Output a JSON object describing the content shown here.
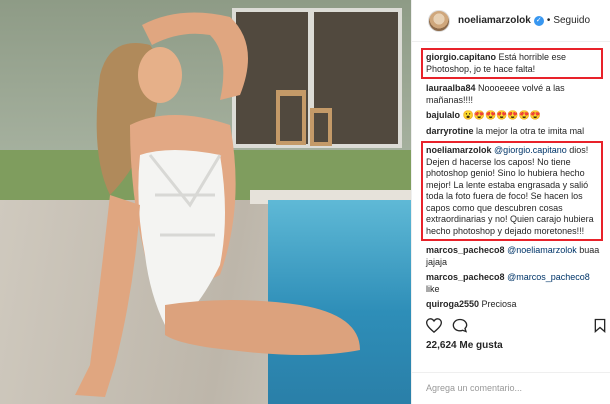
{
  "header": {
    "username": "noeliamarzolok",
    "dot": "•",
    "follow_label": "Seguido"
  },
  "comments": [
    {
      "user": "giorgio.capitano",
      "text": "Está horrible ese Photoshop, jo te hace falta!",
      "highlighted": true
    },
    {
      "user": "lauraalba84",
      "text": "Noooeeee volvé a las mañanas!!!!",
      "highlighted": false
    },
    {
      "user": "bajulalo",
      "text": "😮😍😍😍😍😍😍",
      "highlighted": false
    },
    {
      "user": "darryrotine",
      "text": "la mejor la otra te imita mal",
      "highlighted": false
    },
    {
      "user": "noeliamarzolok",
      "mention": "@giorgio.capitano",
      "text": "dios! Dejen d hacerse los capos! No tiene photoshop genio! Sino lo hubiera hecho mejor! La lente estaba engrasada y salió toda la foto fuera de foco! Se hacen los capos como que descubren cosas extraordinarias y no! Quien carajo hubiera hecho photoshop y dejado moretones!!!",
      "highlighted": true
    },
    {
      "user": "marcos_pacheco8",
      "mention": "@noeliamarzolok",
      "text": "buaa jajaja",
      "highlighted": false
    },
    {
      "user": "marcos_pacheco8",
      "mention": "@marcos_pacheco8",
      "text": "like",
      "highlighted": false
    },
    {
      "user": "quiroga2550",
      "text": "Preciosa",
      "highlighted": false
    }
  ],
  "likes": "22,624 Me gusta",
  "comment_input": {
    "placeholder": "Agrega un comentario..."
  },
  "icons": [
    "heart-icon",
    "comment-icon",
    "bookmark-icon"
  ],
  "colors": {
    "highlight": "#e8222a",
    "verified": "#3897f0",
    "mention": "#003569"
  }
}
